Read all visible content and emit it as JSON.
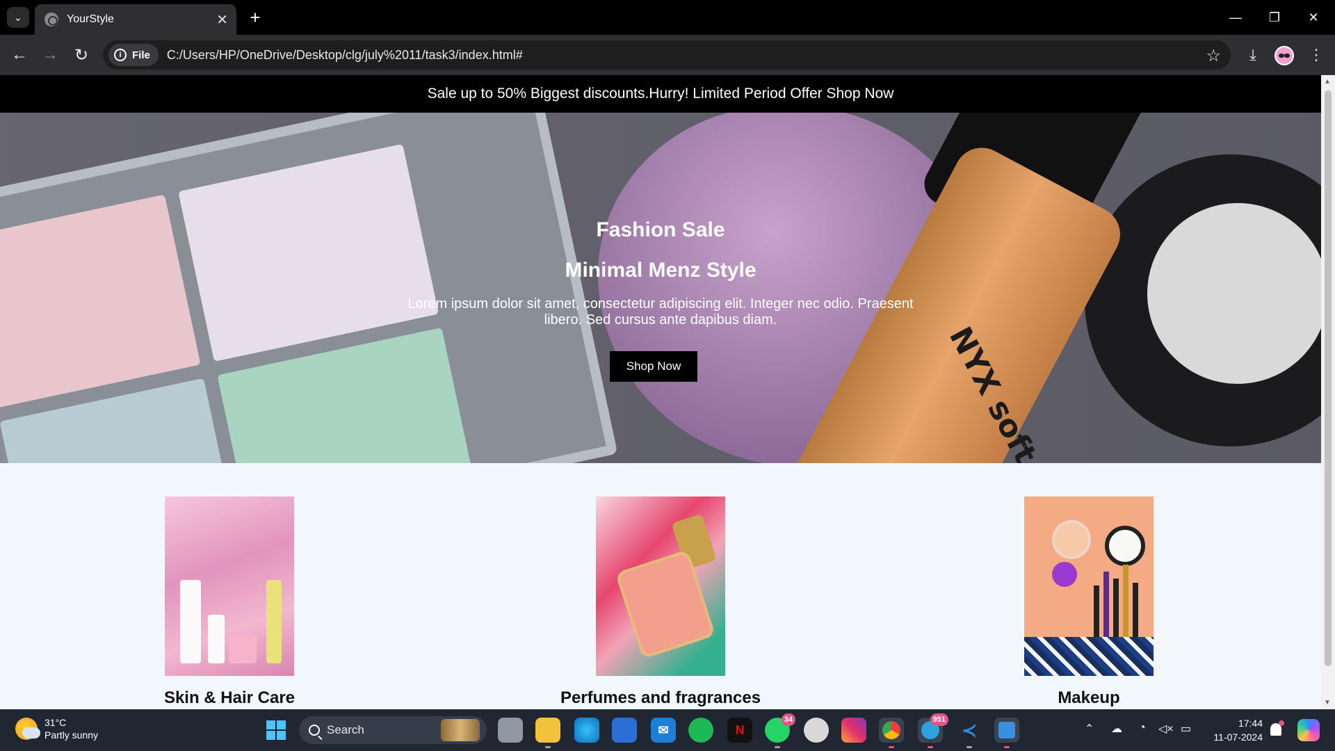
{
  "browser": {
    "tab_title": "YourStyle",
    "new_tab_label": "+",
    "tab_close": "✕",
    "chip_label": "File",
    "url": "C:/Users/HP/OneDrive/Desktop/clg/july%2011/task3/index.html#"
  },
  "page": {
    "promo": "Sale up to 50% Biggest discounts.Hurry! Limited Period Offer Shop Now",
    "hero": {
      "title": "Fashion Sale",
      "subtitle": "Minimal Menz Style",
      "text": "Lorem ipsum dolor sit amet, consectetur adipiscing elit. Integer nec odio. Praesent libero. Sed cursus ante dapibus diam.",
      "button": "Shop Now",
      "brand_mark": "NYX soft matte lip cream"
    },
    "categories": [
      {
        "label": "Skin & Hair Care"
      },
      {
        "label": "Perfumes and fragrances"
      },
      {
        "label": "Makeup"
      }
    ]
  },
  "taskbar": {
    "weather_temp": "31°C",
    "weather_desc": "Partly sunny",
    "search_label": "Search",
    "whatsapp_badge": "34",
    "telegram_badge": "951",
    "time": "17:44",
    "date": "11-07-2024"
  },
  "colors": {
    "promo_bg": "#000000",
    "page_bg": "#f1f7fc",
    "button_bg": "#000000",
    "taskbar_bg": "#202733"
  }
}
